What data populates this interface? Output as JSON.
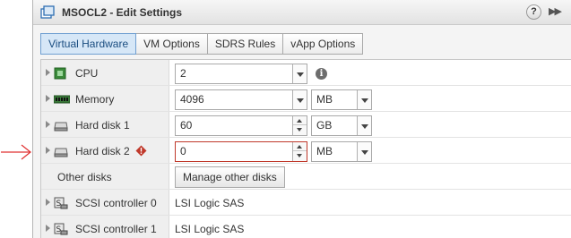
{
  "window": {
    "title": "MSOCL2 - Edit Settings",
    "help_label": "?",
    "expand_label": "▶▶"
  },
  "tabs": [
    {
      "label": "Virtual Hardware",
      "active": true
    },
    {
      "label": "VM Options",
      "active": false
    },
    {
      "label": "SDRS Rules",
      "active": false
    },
    {
      "label": "vApp Options",
      "active": false
    }
  ],
  "rows": {
    "cpu": {
      "label": "CPU",
      "value": "2",
      "icon": "cpu-icon"
    },
    "memory": {
      "label": "Memory",
      "value": "4096",
      "unit": "MB",
      "icon": "memory-icon"
    },
    "hard_disk_1": {
      "label": "Hard disk 1",
      "value": "60",
      "unit": "GB",
      "icon": "hard-disk-icon"
    },
    "hard_disk_2": {
      "label": "Hard disk 2",
      "value": "0",
      "unit": "MB",
      "icon": "hard-disk-icon",
      "warning_icon": "warning-icon"
    },
    "other_disks": {
      "label": "Other disks",
      "button_label": "Manage other disks"
    },
    "scsi_0": {
      "label": "SCSI controller 0",
      "value": "LSI Logic SAS",
      "icon": "scsi-controller-icon"
    },
    "scsi_1": {
      "label": "SCSI controller 1",
      "value": "LSI Logic SAS",
      "icon": "scsi-controller-icon"
    }
  },
  "colors": {
    "active_tab": "#d6e7f7",
    "invalid_border": "#c0392b",
    "annotation_arrow": "#e03030",
    "warning": "#c0392b"
  }
}
